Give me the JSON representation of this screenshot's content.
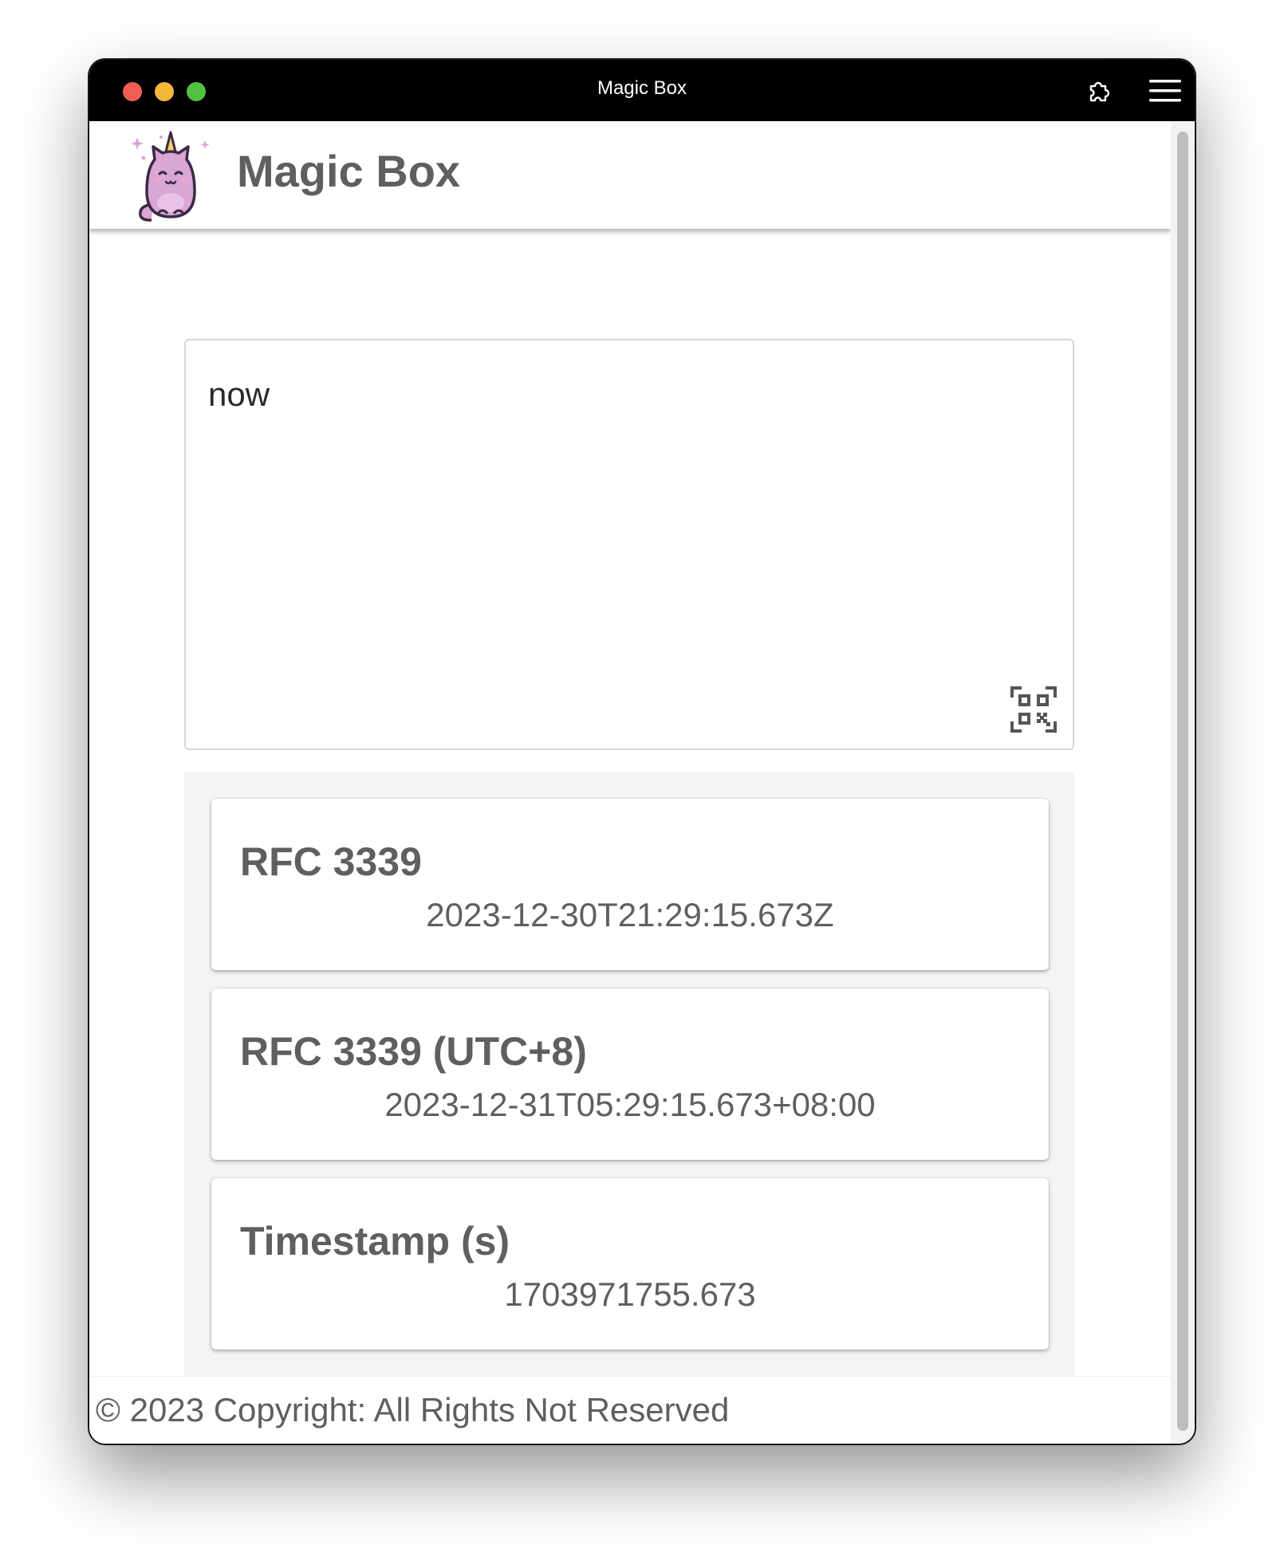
{
  "window": {
    "title": "Magic Box"
  },
  "icons": {
    "extensions": "puzzle-icon",
    "menu": "hamburger-menu-icon",
    "logo": "unicorn-cat-logo",
    "qr": "qr-code-scan-icon"
  },
  "header": {
    "brand": "Magic Box"
  },
  "input": {
    "value": "now"
  },
  "results": [
    {
      "title": "RFC 3339",
      "value": "2023-12-30T21:29:15.673Z"
    },
    {
      "title": "RFC 3339 (UTC+8)",
      "value": "2023-12-31T05:29:15.673+08:00"
    },
    {
      "title": "Timestamp (s)",
      "value": "1703971755.673"
    }
  ],
  "footer": {
    "text": "© 2023 Copyright: All Rights Not Reserved"
  },
  "colors": {
    "titlebar": "#000000",
    "close": "#ee5e56",
    "minimize": "#f3b73a",
    "zoom": "#51c23f",
    "text_gray": "#5f5f5f",
    "logo_pink": "#d9a6d6"
  }
}
